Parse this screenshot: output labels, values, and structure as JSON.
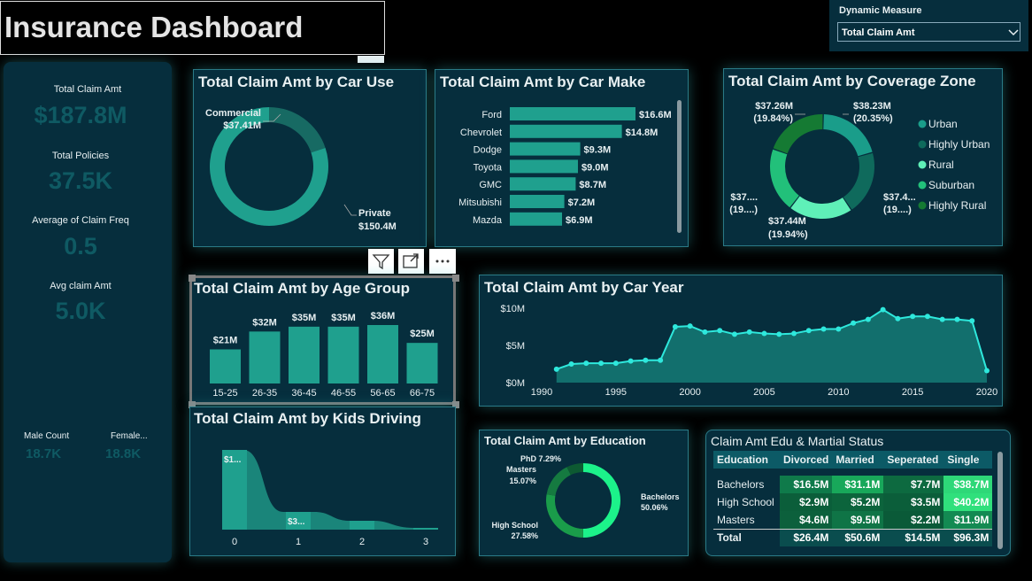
{
  "header": {
    "title": "Insurance Dashboard"
  },
  "slicer": {
    "label": "Dynamic Measure",
    "selected": "Total Claim Amt"
  },
  "kpis": [
    {
      "label": "Total Claim Amt",
      "value": "$187.8M"
    },
    {
      "label": "Total Policies",
      "value": "37.5K"
    },
    {
      "label": "Average of Claim Freq",
      "value": "0.5"
    },
    {
      "label": "Avg claim Amt",
      "value": "5.0K"
    }
  ],
  "gender": [
    {
      "label": "Male Count",
      "value": "18.7K"
    },
    {
      "label": "Female...",
      "value": "18.8K"
    }
  ],
  "chart_data": [
    {
      "type": "donut",
      "title": "Total Claim Amt by Car Use",
      "categories": [
        "Commercial",
        "Private"
      ],
      "values": [
        37.41,
        150.4
      ],
      "labels": [
        "$37.41M",
        "$150.4M"
      ],
      "colors": [
        "#176a63",
        "#1fa08e"
      ]
    },
    {
      "type": "bar",
      "orientation": "horizontal",
      "title": "Total Claim Amt by Car Make",
      "categories": [
        "Ford",
        "Chevrolet",
        "Dodge",
        "Toyota",
        "GMC",
        "Mitsubishi",
        "Mazda"
      ],
      "values": [
        16.6,
        14.8,
        9.3,
        9.0,
        8.7,
        7.2,
        6.9
      ],
      "labels": [
        "$16.6M",
        "$14.8M",
        "$9.3M",
        "$9.0M",
        "$8.7M",
        "$7.2M",
        "$6.9M"
      ],
      "color": "#1fa08e"
    },
    {
      "type": "donut",
      "title": "Total Claim Amt by Coverage Zone",
      "categories": [
        "Urban",
        "Highly Urban",
        "Rural",
        "Suburban",
        "Highly Rural"
      ],
      "values": [
        38.23,
        37.4,
        37.44,
        37.5,
        37.26
      ],
      "slice_labels": [
        "$38.23M",
        "(20.35%)",
        "$37.4...",
        "(19....)",
        "$37.44M",
        "(19.94%)",
        "$37....",
        "(19....)",
        "$37.26M",
        "(19.84%)"
      ],
      "colors": [
        "#1a9d8a",
        "#0f6a5c",
        "#5ff0b8",
        "#22c07a",
        "#157a33"
      ],
      "legend_position": "right"
    },
    {
      "type": "bar",
      "title": "Total Claim Amt by Age Group",
      "categories": [
        "15-25",
        "26-35",
        "36-45",
        "46-55",
        "56-65",
        "66-75"
      ],
      "values": [
        21,
        32,
        35,
        35,
        36,
        25
      ],
      "labels": [
        "$21M",
        "$32M",
        "$35M",
        "$35M",
        "$36M",
        "$25M"
      ],
      "color": "#1fa08e"
    },
    {
      "type": "area",
      "title": "Total Claim Amt by Car Year",
      "x": [
        1991,
        1992,
        1993,
        1994,
        1995,
        1996,
        1997,
        1998,
        1999,
        2000,
        2001,
        2002,
        2003,
        2004,
        2005,
        2006,
        2007,
        2008,
        2009,
        2010,
        2011,
        2012,
        2013,
        2014,
        2015,
        2016,
        2017,
        2018,
        2019,
        2020
      ],
      "values": [
        1.8,
        2.5,
        2.6,
        2.6,
        2.6,
        2.9,
        3.0,
        3.0,
        7.5,
        7.6,
        6.8,
        7.0,
        6.5,
        6.8,
        6.6,
        6.5,
        6.6,
        7.0,
        7.2,
        7.2,
        8.0,
        8.5,
        9.8,
        8.6,
        8.9,
        8.9,
        8.5,
        8.5,
        8.3,
        1.6
      ],
      "xticks": [
        "1990",
        "1995",
        "2000",
        "2005",
        "2010",
        "2015",
        "2020"
      ],
      "yticks": [
        "$0M",
        "$5M",
        "$10M"
      ],
      "ylim": [
        0,
        10
      ],
      "color": "#2ee8dc"
    },
    {
      "type": "area",
      "title": "Total Claim Amt by Kids Driving",
      "categories": [
        "0",
        "1",
        "2",
        "3"
      ],
      "labels": [
        "$1...",
        "$3..."
      ],
      "color": "#1fa08e"
    },
    {
      "type": "donut",
      "title": "Total Claim Amt by Education",
      "categories": [
        "Bachelors",
        "High School",
        "Masters",
        "PhD"
      ],
      "values": [
        50.06,
        27.58,
        15.07,
        7.29
      ],
      "labels": [
        "Bachelors",
        "50.06%",
        "High School",
        "27.58%",
        "Masters",
        "15.07%",
        "PhD 7.29%"
      ],
      "colors": [
        "#1cf28a",
        "#1a9c4a",
        "#157a40",
        "#0d5a32"
      ]
    },
    {
      "type": "table",
      "title": "Claim Amt Edu & Martial Status",
      "columns": [
        "Education",
        "Divorced",
        "Married",
        "Seperated",
        "Single"
      ],
      "rows": [
        [
          "Bachelors",
          "$16.5M",
          "$31.1M",
          "$7.7M",
          "$38.7M"
        ],
        [
          "High School",
          "$2.9M",
          "$5.2M",
          "$3.5M",
          "$40.2M"
        ],
        [
          "Masters",
          "$4.6M",
          "$9.5M",
          "$2.2M",
          "$11.9M"
        ]
      ],
      "total": [
        "Total",
        "$26.4M",
        "$50.6M",
        "$14.5M",
        "$96.3M"
      ]
    }
  ]
}
